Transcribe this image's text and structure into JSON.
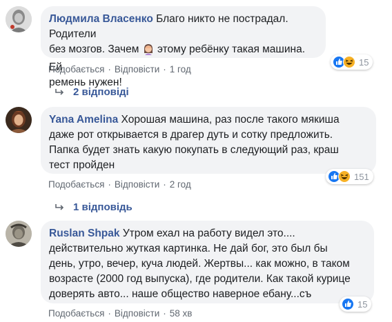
{
  "comments": [
    {
      "author": "Людмила Власенко",
      "text_1": "Благо никто не пострадал. Родители",
      "text_2a": "без мозгов. Зачем",
      "text_2b": "этому ребёнку такая машина. Ей",
      "text_3": "ремень нужен!",
      "emoji": "woman-facepalm-emoji",
      "like_label": "Подобається",
      "reply_label": "Відповісти",
      "time": "1 год",
      "reaction_count": "15",
      "reactions": [
        "like-icon",
        "haha-icon"
      ],
      "replies_label": "2 відповіді"
    },
    {
      "author": "Yana Amelina",
      "text_1": "Хорошая машина, раз после такого мякиша",
      "text_2": "даже рот открывается в драгер дуть и сотку предложить.",
      "text_3": "Папка будет знать какую покупать в следующий раз, краш",
      "text_4": "тест пройден",
      "like_label": "Подобається",
      "reply_label": "Відповісти",
      "time": "2 год",
      "reaction_count": "151",
      "reactions": [
        "like-icon",
        "haha-icon"
      ],
      "replies_label": "1 відповідь"
    },
    {
      "author": "Ruslan Shpak",
      "text_1": "Утром ехал на работу видел это....",
      "text_2": "действительно жуткая картинка. Не дай бог, это был бы",
      "text_3": "день, утро, вечер, куча людей. Жертвы... как можно, в таком",
      "text_4": "возрасте (2000 год выпуска), где родители. Как такой курице",
      "text_5": "доверять авто... наше общество наверное ебану...съ",
      "like_label": "Подобається",
      "reply_label": "Відповісти",
      "time": "58 хв",
      "reaction_count": "15",
      "reactions": [
        "like-icon"
      ]
    }
  ],
  "colors": {
    "link": "#385898",
    "bubble": "#f2f3f5",
    "meta": "#606770",
    "like_blue": "#1877f2",
    "haha_yellow": "#f7b125"
  }
}
